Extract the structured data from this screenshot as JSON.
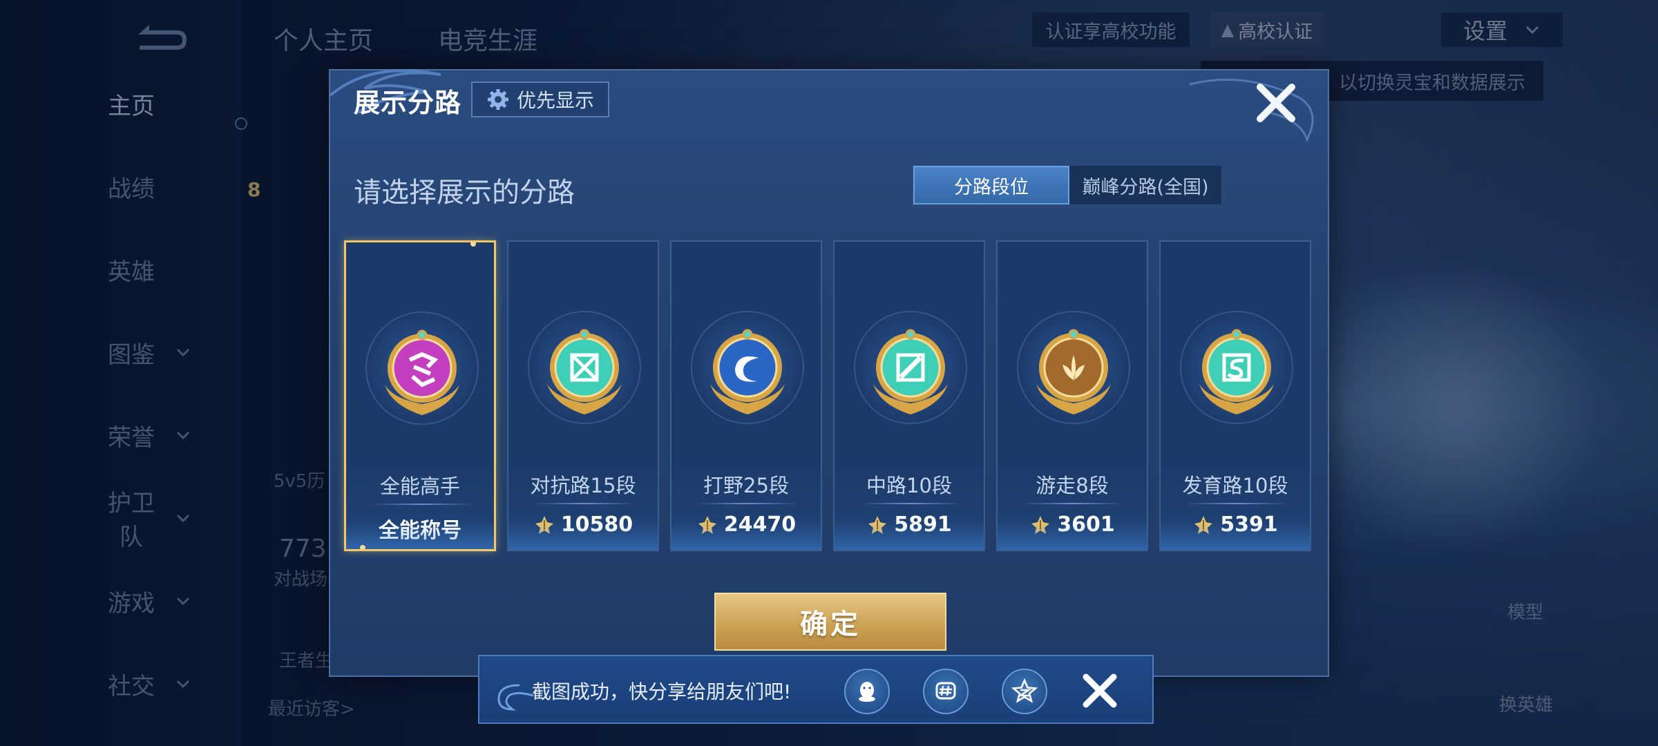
{
  "top_tabs": [
    "个人主页",
    "电竞生涯"
  ],
  "top_right": {
    "cert_hint": "认证享高校功能",
    "cert_button": "高校认证",
    "settings": "设置",
    "hint_partial": "以切换灵宝和数据展示"
  },
  "nav": [
    {
      "label": "主页",
      "active": true,
      "chevron": false
    },
    {
      "label": "战绩",
      "active": false,
      "chevron": false
    },
    {
      "label": "英雄",
      "active": false,
      "chevron": false
    },
    {
      "label": "图鉴",
      "active": false,
      "chevron": true
    },
    {
      "label": "荣誉",
      "active": false,
      "chevron": true
    },
    {
      "label": "护卫队",
      "active": false,
      "chevron": true
    },
    {
      "label": "游戏",
      "active": false,
      "chevron": true
    },
    {
      "label": "社交",
      "active": false,
      "chevron": true
    }
  ],
  "background_fragments": {
    "level": "8",
    "history": "5v5历",
    "number": "773",
    "battle": "对战场",
    "king": "王者生",
    "visitors": "最近访客>",
    "model": "模型",
    "change_hero": "换英雄"
  },
  "modal": {
    "title": "展示分路",
    "priority_button": "优先显示",
    "subtitle": "请选择展示的分路",
    "segments": [
      {
        "label": "分路段位",
        "active": true
      },
      {
        "label": "巅峰分路(全国)",
        "active": false
      }
    ],
    "cards": [
      {
        "name": "全能高手",
        "value": "全能称号",
        "selected": true,
        "show_icon": false,
        "badge": "allround-badge-icon",
        "badge_color": "#c43fc0"
      },
      {
        "name": "对抗路15段",
        "value": "10580",
        "selected": false,
        "show_icon": true,
        "badge": "clash-lane-badge-icon",
        "badge_color": "#3fcfb6"
      },
      {
        "name": "打野25段",
        "value": "24470",
        "selected": false,
        "show_icon": true,
        "badge": "jungle-badge-icon",
        "badge_color": "#2a66c4"
      },
      {
        "name": "中路10段",
        "value": "5891",
        "selected": false,
        "show_icon": true,
        "badge": "mid-lane-badge-icon",
        "badge_color": "#3fcfb6"
      },
      {
        "name": "游走8段",
        "value": "3601",
        "selected": false,
        "show_icon": true,
        "badge": "roam-badge-icon",
        "badge_color": "#a36a2e"
      },
      {
        "name": "发育路10段",
        "value": "5391",
        "selected": false,
        "show_icon": true,
        "badge": "farm-lane-badge-icon",
        "badge_color": "#3fcfb6"
      }
    ],
    "confirm": "确定"
  },
  "toast": {
    "text": "截图成功，快分享给朋友们吧!",
    "share_icons": [
      "qq-icon",
      "hashtag-icon",
      "qzone-icon"
    ]
  },
  "colors": {
    "accent_gold": "#f0c869",
    "modal_bg": "#24426f",
    "selected_tab": "#3f78bd"
  }
}
